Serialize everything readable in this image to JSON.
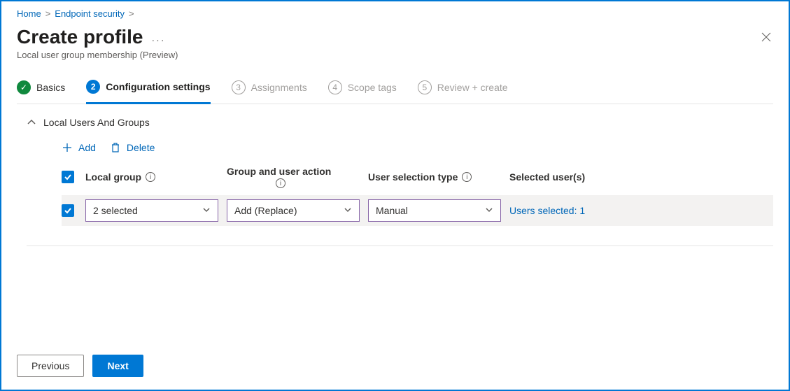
{
  "breadcrumbs": {
    "home": "Home",
    "endpoint": "Endpoint security"
  },
  "header": {
    "title": "Create profile",
    "subtitle": "Local user group membership (Preview)",
    "dots": "···"
  },
  "wizard": {
    "step1": "Basics",
    "step2_num": "2",
    "step2": "Configuration settings",
    "step3_num": "3",
    "step3": "Assignments",
    "step4_num": "4",
    "step4": "Scope tags",
    "step5_num": "5",
    "step5": "Review + create"
  },
  "section": {
    "title": "Local Users And Groups"
  },
  "actions": {
    "add": "Add",
    "del": "Delete"
  },
  "columns": {
    "local_group": "Local group",
    "group_user_action": "Group and user action",
    "user_selection_type": "User selection type",
    "selected_users": "Selected user(s)"
  },
  "row": {
    "local_group_value": "2 selected",
    "action_value": "Add (Replace)",
    "selection_value": "Manual",
    "selected_link": "Users selected: 1"
  },
  "footer": {
    "prev": "Previous",
    "next": "Next"
  }
}
